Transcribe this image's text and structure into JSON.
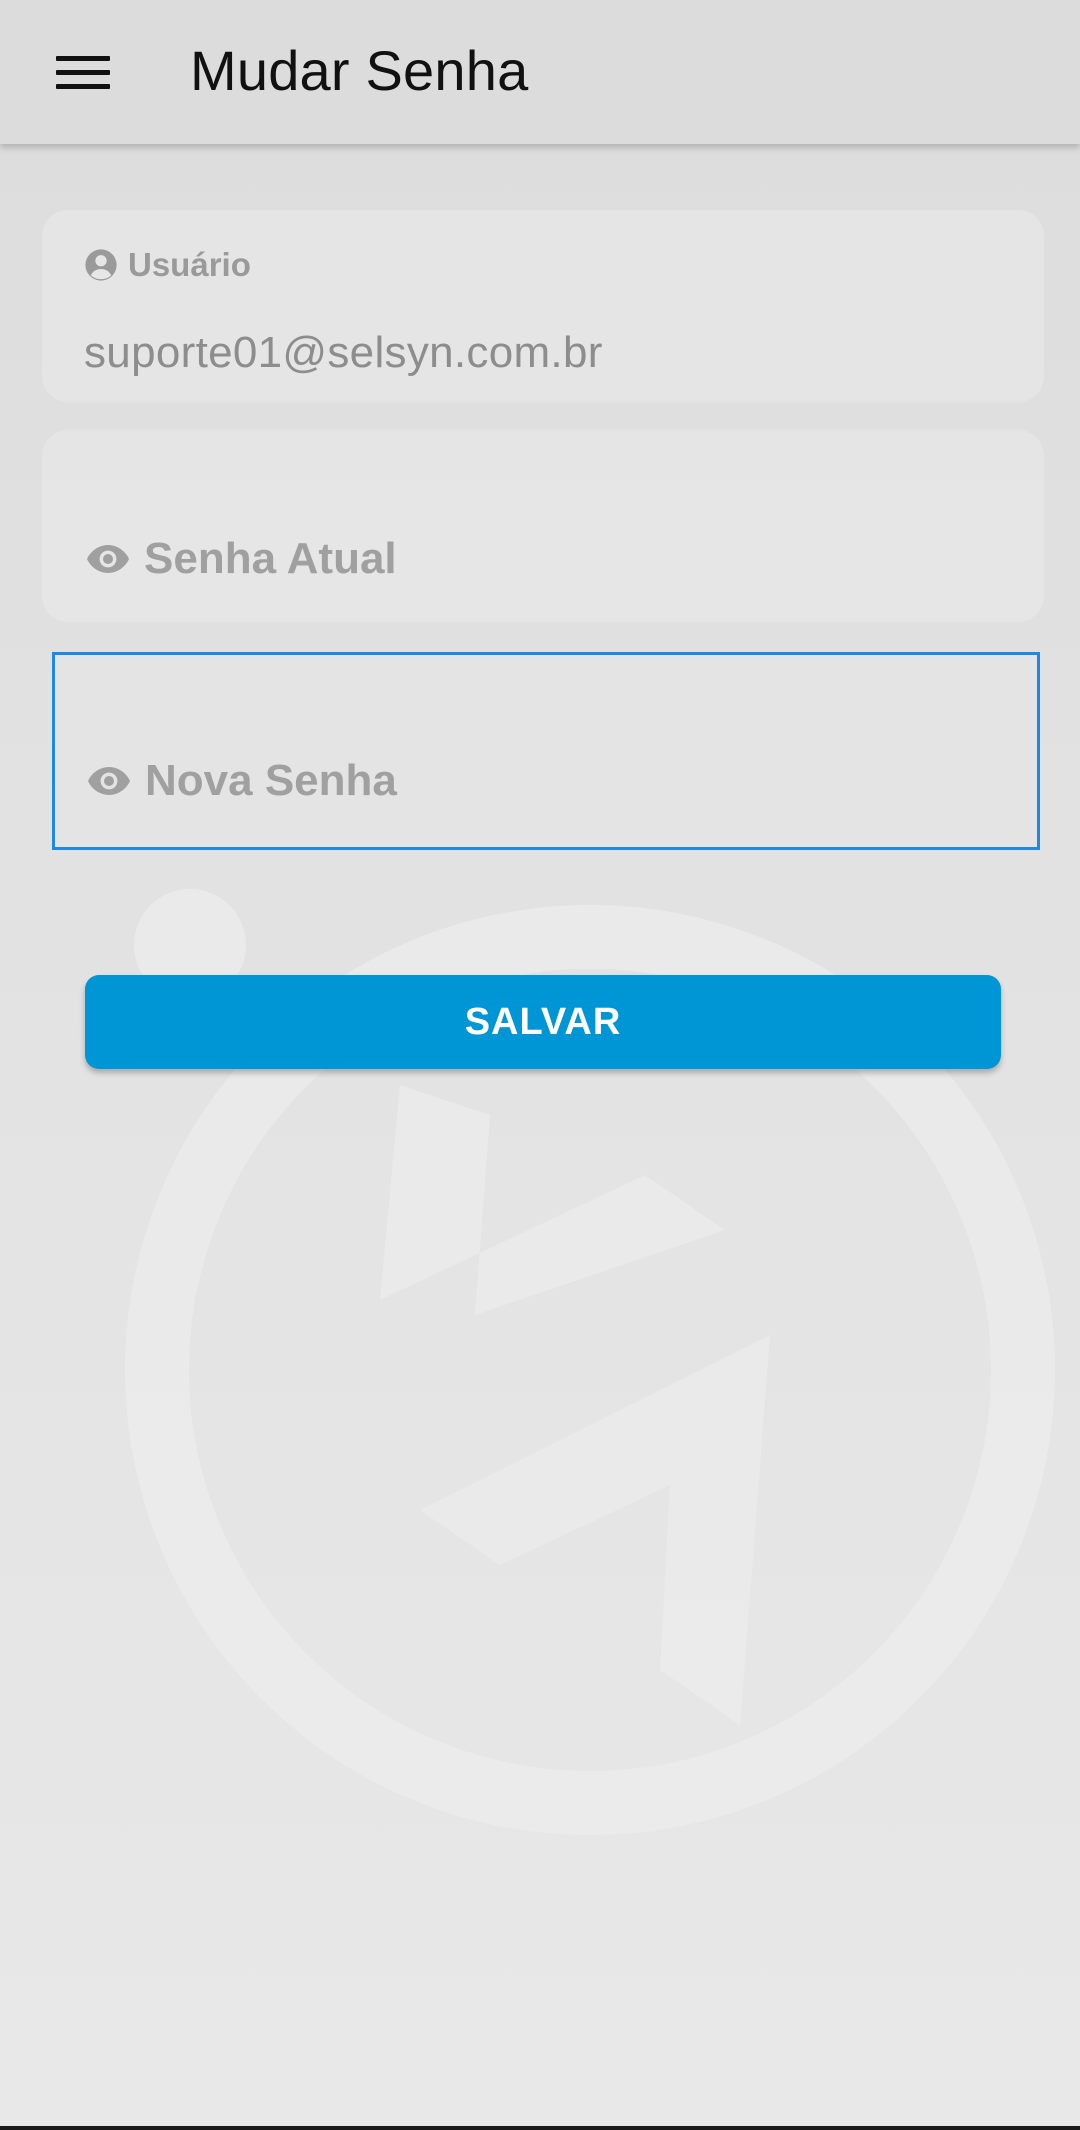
{
  "app_bar": {
    "title": "Mudar Senha",
    "menu_icon": "hamburger-menu-icon"
  },
  "form": {
    "user": {
      "label": "Usuário",
      "value": "suporte01@selsyn.com.br",
      "icon": "user-circle-icon"
    },
    "current_password": {
      "placeholder": "Senha Atual",
      "icon": "eye-icon"
    },
    "new_password": {
      "placeholder": "Nova Senha",
      "icon": "eye-icon"
    },
    "save_label": "SALVAR"
  },
  "colors": {
    "accent": "#0095d5",
    "focus_border": "#1e88e5"
  }
}
